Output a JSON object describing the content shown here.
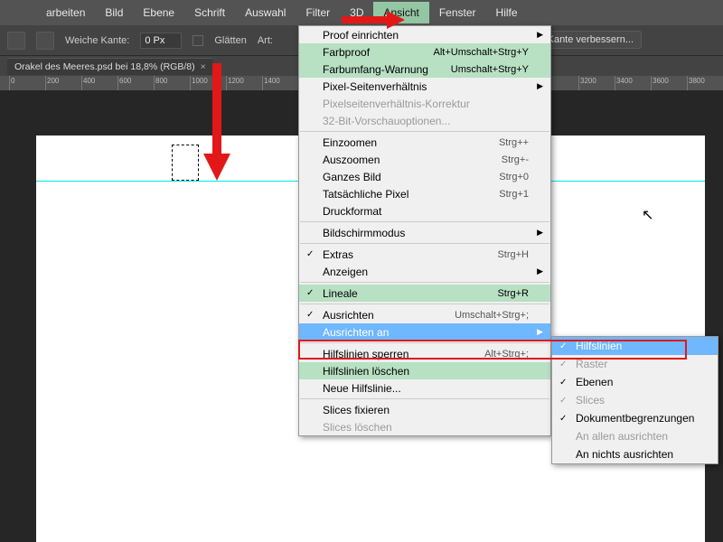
{
  "menubar": {
    "items": [
      "arbeiten",
      "Bild",
      "Ebene",
      "Schrift",
      "Auswahl",
      "Filter",
      "3D",
      "Ansicht",
      "Fenster",
      "Hilfe"
    ],
    "open_index": 7
  },
  "toolbar": {
    "soft_edge_label": "Weiche Kante:",
    "soft_edge_value": "0 Px",
    "smooth_label": "Glätten",
    "type_label": "Art:",
    "improve_edge": "Kante verbessern..."
  },
  "tab": {
    "title": "Orakel des Meeres.psd bei 18,8% (RGB/8)",
    "close": "×"
  },
  "ruler_ticks": [
    0,
    200,
    400,
    600,
    800,
    1000,
    1200,
    1400,
    3200,
    3400,
    3600,
    3800
  ],
  "menu": [
    {
      "label": "Proof einrichten",
      "arrow": true
    },
    {
      "label": "Farbproof",
      "shortcut": "Alt+Umschalt+Strg+Y",
      "green": true
    },
    {
      "label": "Farbumfang-Warnung",
      "shortcut": "Umschalt+Strg+Y",
      "green": true
    },
    {
      "label": "Pixel-Seitenverhältnis",
      "arrow": true
    },
    {
      "label": "Pixelseitenverhältnis-Korrektur",
      "disabled": true
    },
    {
      "label": "32-Bit-Vorschauoptionen...",
      "disabled": true
    },
    {
      "sep": true
    },
    {
      "label": "Einzoomen",
      "shortcut": "Strg++"
    },
    {
      "label": "Auszoomen",
      "shortcut": "Strg+-"
    },
    {
      "label": "Ganzes Bild",
      "shortcut": "Strg+0"
    },
    {
      "label": "Tatsächliche Pixel",
      "shortcut": "Strg+1"
    },
    {
      "label": "Druckformat"
    },
    {
      "sep": true
    },
    {
      "label": "Bildschirmmodus",
      "arrow": true
    },
    {
      "sep": true
    },
    {
      "label": "Extras",
      "shortcut": "Strg+H",
      "check": true
    },
    {
      "label": "Anzeigen",
      "arrow": true
    },
    {
      "sep": true
    },
    {
      "label": "Lineale",
      "shortcut": "Strg+R",
      "check": true,
      "green": true
    },
    {
      "sep": true
    },
    {
      "label": "Ausrichten",
      "shortcut": "Umschalt+Strg+;",
      "check": true
    },
    {
      "label": "Ausrichten an",
      "arrow": true,
      "highlight": true
    },
    {
      "sep": true
    },
    {
      "label": "Hilfslinien sperren",
      "shortcut": "Alt+Strg+;"
    },
    {
      "label": "Hilfslinien löschen",
      "green": true
    },
    {
      "label": "Neue Hilfslinie..."
    },
    {
      "sep": true
    },
    {
      "label": "Slices fixieren"
    },
    {
      "label": "Slices löschen",
      "disabled": true
    }
  ],
  "submenu": [
    {
      "label": "Hilfslinien",
      "check": true,
      "highlight": true
    },
    {
      "label": "Raster",
      "check": true,
      "disabled": true
    },
    {
      "label": "Ebenen",
      "check": true
    },
    {
      "label": "Slices",
      "check": true,
      "disabled": true
    },
    {
      "label": "Dokumentbegrenzungen",
      "check": true
    },
    {
      "sep": true
    },
    {
      "label": "An allen ausrichten",
      "disabled": true
    },
    {
      "label": "An nichts ausrichten"
    }
  ]
}
